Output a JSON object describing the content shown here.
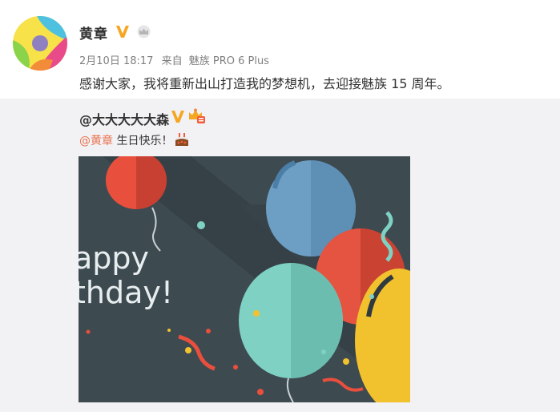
{
  "post": {
    "author": "黄章",
    "verified_icon": "verified-v-icon",
    "crown_icon": "crown-icon",
    "date": "2月10日 18:17",
    "source_prefix": "来自",
    "source": "魅族 PRO 6 Plus",
    "text": "感谢大家，我将重新出山打造我的梦想机，去迎接魅族 15 周年。"
  },
  "repost": {
    "author": "@大大大大大森",
    "mention": "@黄章",
    "message": " 生日快乐！",
    "cake_icon": "birthday-cake-icon",
    "image": {
      "caption_line1": "appy",
      "caption_line2": "thday!"
    }
  },
  "colors": {
    "accent_orange": "#eb7350",
    "verified_gold": "#f5a623",
    "repost_background": "#f2f2f5",
    "image_background": "#3d4a50"
  }
}
